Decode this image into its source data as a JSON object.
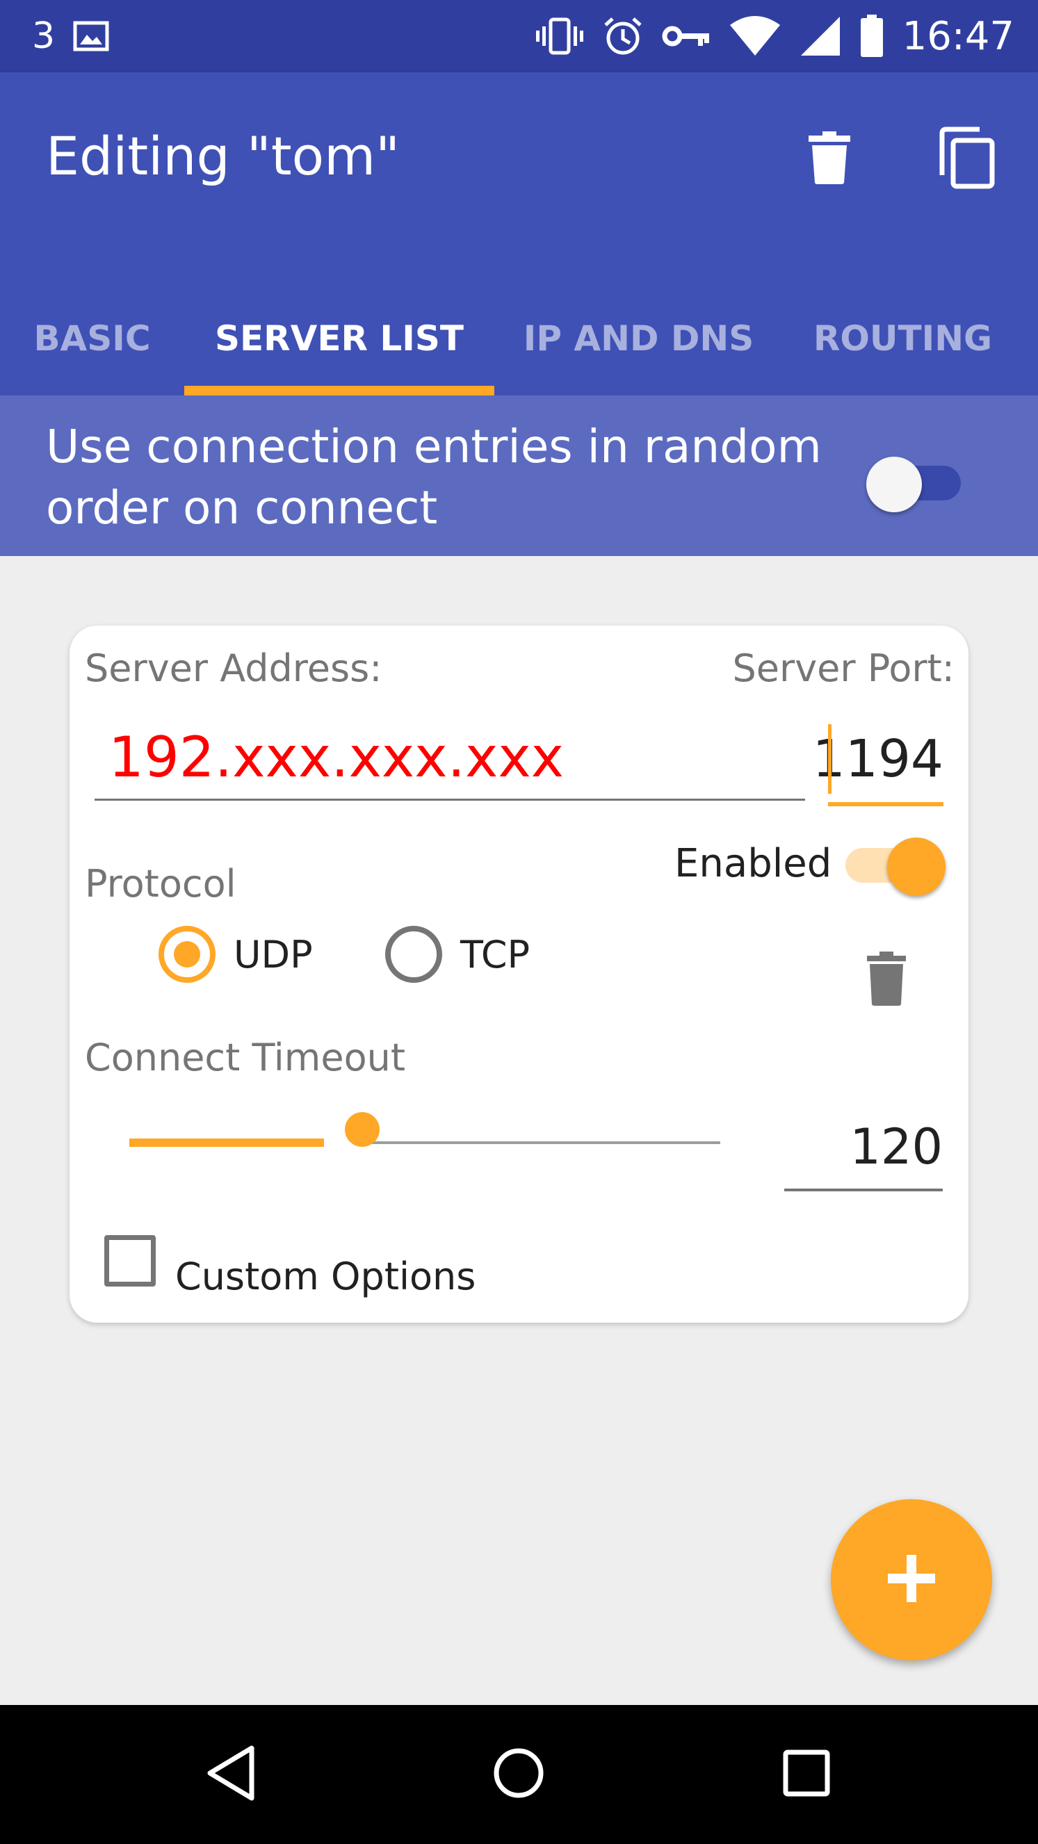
{
  "status_bar": {
    "notification_count": "3",
    "time": "16:47",
    "icons": [
      "image-icon",
      "vibrate-icon",
      "alarm-icon",
      "vpn-key-icon",
      "wifi-icon",
      "signal-icon",
      "battery-icon"
    ]
  },
  "app_bar": {
    "title": "Editing \"tom\"",
    "actions": [
      "delete-icon",
      "copy-icon"
    ]
  },
  "tabs": [
    {
      "label": "BASIC",
      "active": false
    },
    {
      "label": "SERVER LIST",
      "active": true
    },
    {
      "label": "IP AND DNS",
      "active": false
    },
    {
      "label": "ROUTING",
      "active": false
    }
  ],
  "random_order": {
    "label": "Use connection entries in random order on connect",
    "enabled": false
  },
  "server_card": {
    "server_address_label": "Server Address:",
    "server_port_label": "Server Port:",
    "server_address_value": "192.xxx.xxx.xxx",
    "server_port_value": "1194",
    "enabled_label": "Enabled",
    "enabled": true,
    "protocol_label": "Protocol",
    "protocol_options": [
      {
        "label": "UDP",
        "checked": true
      },
      {
        "label": "TCP",
        "checked": false
      }
    ],
    "connect_timeout_label": "Connect Timeout",
    "connect_timeout_value": "120",
    "slider_level": 0.4,
    "custom_options_label": "Custom Options",
    "custom_options_checked": false
  },
  "fab": {
    "icon": "add-icon"
  },
  "colors": {
    "primary": "#3F51B5",
    "primary_dark": "#303F9F",
    "accent": "#FFA726",
    "address_text": "#FF0000"
  },
  "navigation": [
    "back-icon",
    "home-icon",
    "recents-icon"
  ]
}
